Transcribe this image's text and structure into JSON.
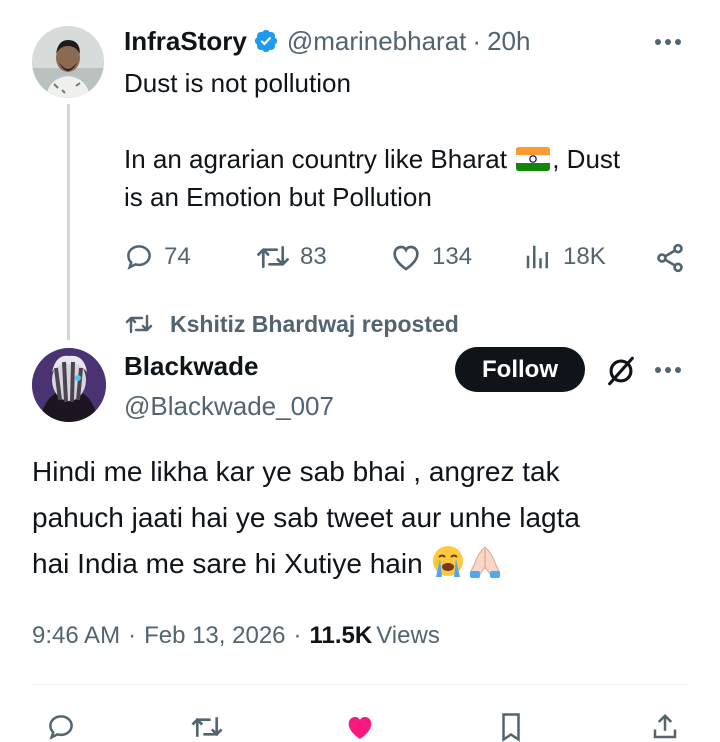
{
  "parent_tweet": {
    "display_name": "InfraStory",
    "handle": "@marinebharat",
    "separator": "·",
    "time_ago": "20h",
    "line1": "Dust is not pollution",
    "line2_before_flag": "In an agrarian country like Bharat",
    "line2_after_flag": ", Dust",
    "line3": "is an Emotion but Pollution",
    "stats": {
      "replies": "74",
      "reposts": "83",
      "likes": "134",
      "views": "18K"
    }
  },
  "repost_banner": {
    "text": "Kshitiz Bhardwaj reposted"
  },
  "main_tweet": {
    "display_name": "Blackwade",
    "handle": "@Blackwade_007",
    "follow_label": "Follow",
    "body_line1": "Hindi me likha kar ye sab bhai , angrez tak",
    "body_line2": "pahuch jaati hai ye sab tweet aur unhe lagta",
    "body_line3": "hai India me sare hi Xutiye hain",
    "time": "9:46 AM",
    "date_sep": "·",
    "date": "Feb 13, 2026",
    "views_sep": "·",
    "views_count": "11.5K",
    "views_label": "Views"
  },
  "colors": {
    "verified_blue": "#1d9bf0",
    "text_primary": "#0f1419",
    "text_muted": "#536471",
    "like_pink": "#f91880"
  }
}
